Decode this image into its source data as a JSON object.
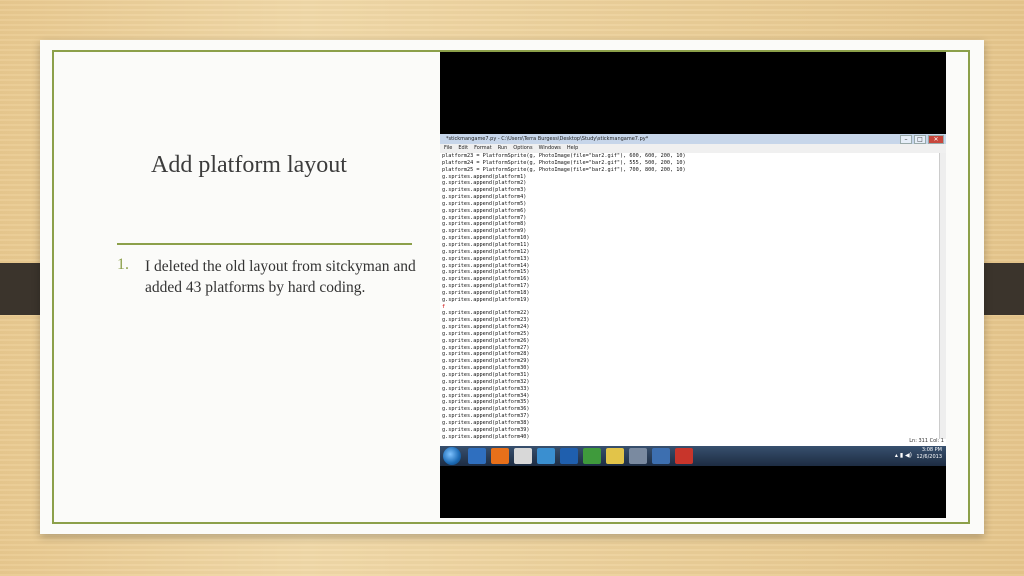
{
  "slide": {
    "title": "Add platform layout",
    "list_number": "1.",
    "list_text": "I deleted the old layout from sitckyman and added 43 platforms by hard coding."
  },
  "window": {
    "title": "*stickmangame7.py - C:\\Users\\Terra Burgess\\Desktop\\Study\\stickmangame7.py*",
    "menu": [
      "File",
      "Edit",
      "Format",
      "Run",
      "Options",
      "Windows",
      "Help"
    ],
    "code_lines": [
      "platform23 = PlatformSprite(g, PhotoImage(file=\"bar2.gif\"), 600, 600, 200, 10)",
      "platform24 = PlatformSprite(g, PhotoImage(file=\"bar2.gif\"), 555, 500, 200, 10)",
      "platform25 = PlatformSprite(g, PhotoImage(file=\"bar2.gif\"), 700, 800, 200, 10)",
      "g.sprites.append(platform1)",
      "g.sprites.append(platform2)",
      "g.sprites.append(platform3)",
      "g.sprites.append(platform4)",
      "g.sprites.append(platform5)",
      "g.sprites.append(platform6)",
      "g.sprites.append(platform7)",
      "g.sprites.append(platform8)",
      "g.sprites.append(platform9)",
      "g.sprites.append(platform10)",
      "g.sprites.append(platform11)",
      "g.sprites.append(platform12)",
      "g.sprites.append(platform13)",
      "g.sprites.append(platform14)",
      "g.sprites.append(platform15)",
      "g.sprites.append(platform16)",
      "g.sprites.append(platform17)",
      "g.sprites.append(platform18)",
      "g.sprites.append(platform19)",
      "f",
      "g.sprites.append(platform22)",
      "g.sprites.append(platform23)",
      "g.sprites.append(platform24)",
      "g.sprites.append(platform25)",
      "g.sprites.append(platform26)",
      "g.sprites.append(platform27)",
      "g.sprites.append(platform28)",
      "g.sprites.append(platform29)",
      "g.sprites.append(platform30)",
      "g.sprites.append(platform31)",
      "g.sprites.append(platform32)",
      "g.sprites.append(platform33)",
      "g.sprites.append(platform34)",
      "g.sprites.append(platform35)",
      "g.sprites.append(platform36)",
      "g.sprites.append(platform37)",
      "g.sprites.append(platform38)",
      "g.sprites.append(platform39)",
      "g.sprites.append(platform40)"
    ],
    "status": "Ln: 311 Col: 1"
  },
  "taskbar": {
    "time": "3:08 PM",
    "date": "12/6/2013",
    "app_colors": [
      "#2f6fbf",
      "#e8701a",
      "#d8d8d8",
      "#3a8fd0",
      "#1f5fae",
      "#3f9a3c",
      "#e2c449",
      "#7a8aa0",
      "#3d6fb0",
      "#c8352b"
    ]
  },
  "colors": {
    "accent": "#8ca04a",
    "tab": "#3b342c"
  }
}
